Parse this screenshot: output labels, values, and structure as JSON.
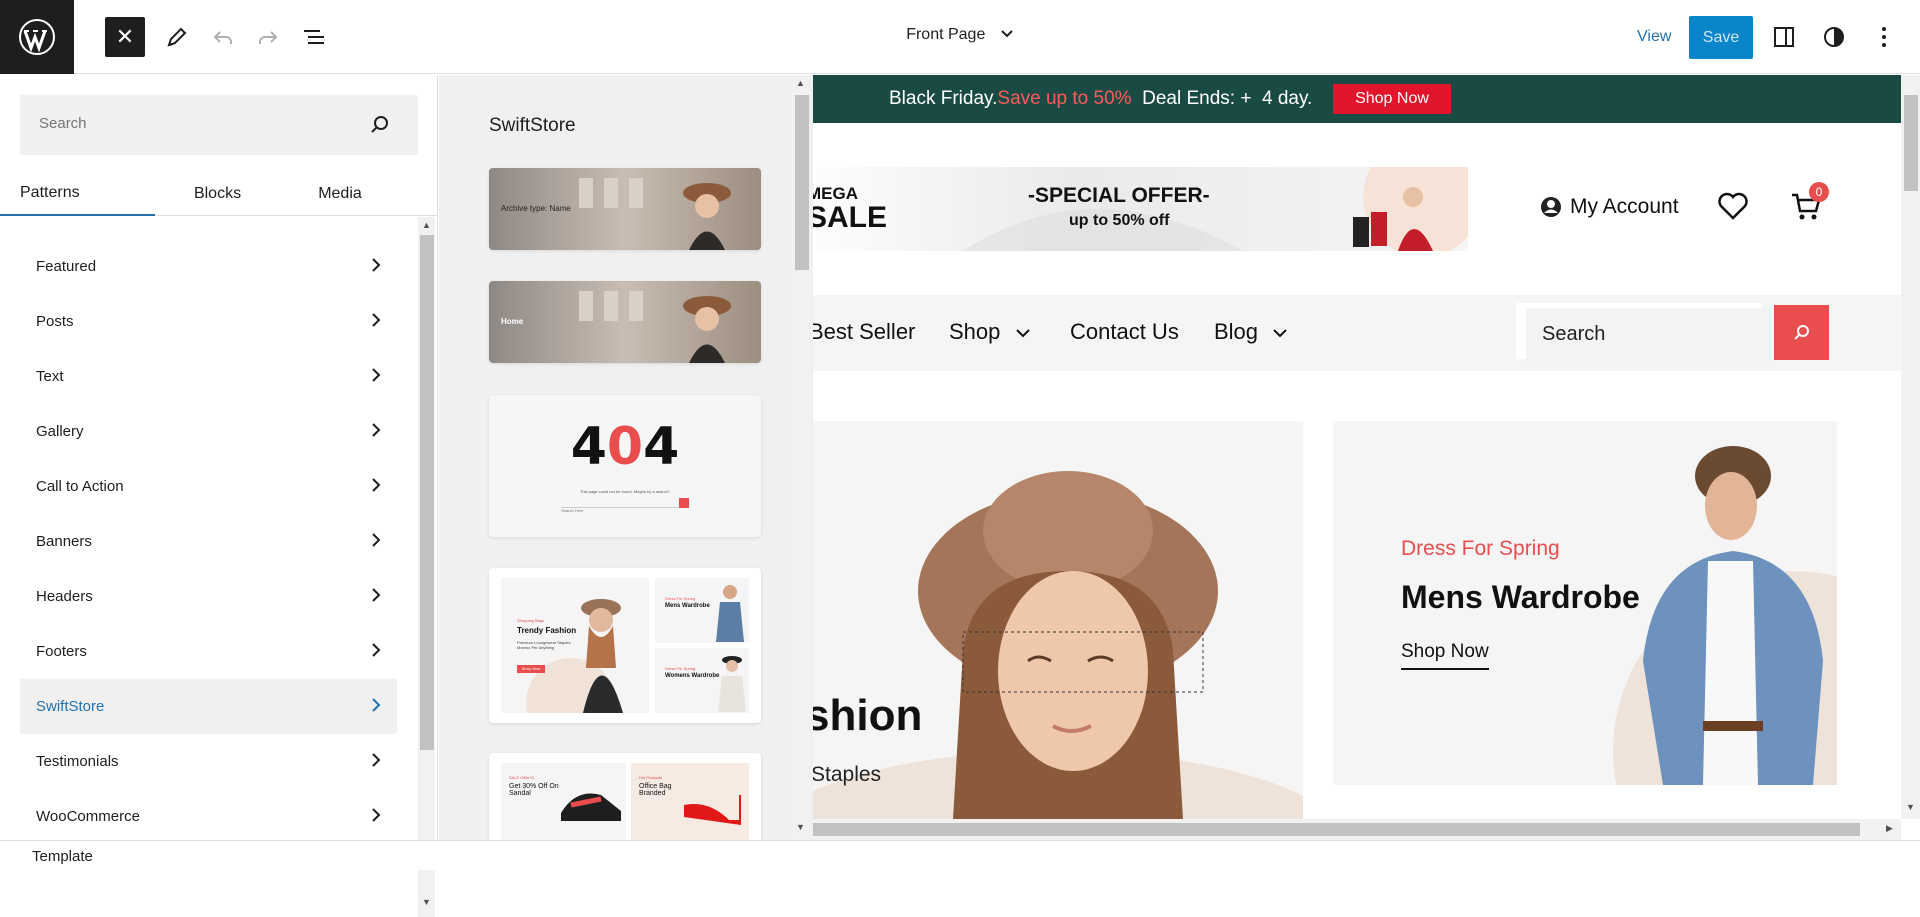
{
  "toolbar": {
    "document_title": "Front Page",
    "view_label": "View",
    "save_label": "Save"
  },
  "sidebar": {
    "search_placeholder": "Search",
    "tabs": [
      {
        "label": "Patterns",
        "active": true
      },
      {
        "label": "Blocks",
        "active": false
      },
      {
        "label": "Media",
        "active": false
      }
    ],
    "categories": [
      {
        "label": "Featured"
      },
      {
        "label": "Posts"
      },
      {
        "label": "Text"
      },
      {
        "label": "Gallery"
      },
      {
        "label": "Call to Action"
      },
      {
        "label": "Banners"
      },
      {
        "label": "Headers"
      },
      {
        "label": "Footers"
      },
      {
        "label": "SwiftStore",
        "active": true
      },
      {
        "label": "Testimonials"
      },
      {
        "label": "WooCommerce"
      }
    ]
  },
  "patterns_panel": {
    "title": "SwiftStore",
    "items": [
      {
        "caption": "Archive type: Name"
      },
      {
        "caption": "Home"
      },
      {
        "big_text_a": "4",
        "big_text_b": "0",
        "big_text_c": "4",
        "message": "This page could not be found. Maybe try a search?",
        "search_placeholder": "Search Here"
      },
      {
        "eyebrow": "Shopping Bags",
        "title": "Trendy Fashion",
        "sub": "Premium Loungewear Staples Moreso Per Anything",
        "btn": "Shop Now",
        "card1_eyebrow": "Dress For Spring",
        "card1_title": "Mens Wardrobe",
        "card2_eyebrow": "Dress For Spring",
        "card2_title": "Womens Wardrobe"
      },
      {
        "card1_eyebrow": "SALE Offer Si",
        "card1_title": "Get 30% Off On Sandal",
        "card2_eyebrow": "Hot Products",
        "card2_title": "Office Bag Branded"
      }
    ]
  },
  "canvas": {
    "promo": {
      "text_start": "Black Friday.",
      "text_red": "Save up to 50%",
      "text_end": "  Deal Ends: +  4 day.",
      "button": "Shop Now"
    },
    "banner": {
      "left_top": "MEGA",
      "left_bottom": "SALE",
      "offer": "-SPECIAL OFFER-",
      "offer_sub": "up to 50% off"
    },
    "account_label": "My Account",
    "cart_count": "0",
    "nav": [
      {
        "label": "Best Seller",
        "has_dropdown": false
      },
      {
        "label": "Shop",
        "has_dropdown": true
      },
      {
        "label": "Contact Us",
        "has_dropdown": false
      },
      {
        "label": "Blog",
        "has_dropdown": true
      }
    ],
    "nav_search_placeholder": "Search",
    "hero_left": {
      "title_fragment": "shion",
      "sub_fragment": "Staples"
    },
    "hero_right": {
      "eyebrow": "Dress For Spring",
      "title": "Mens Wardrobe",
      "link": "Shop Now"
    }
  },
  "footer": {
    "breadcrumb": "Template"
  },
  "colors": {
    "accent_blue": "#2271b1",
    "save_button": "#0a85c9",
    "promo_bg": "#1a4a44",
    "brand_red": "#e94d4d",
    "shop_button": "#e0142a"
  }
}
